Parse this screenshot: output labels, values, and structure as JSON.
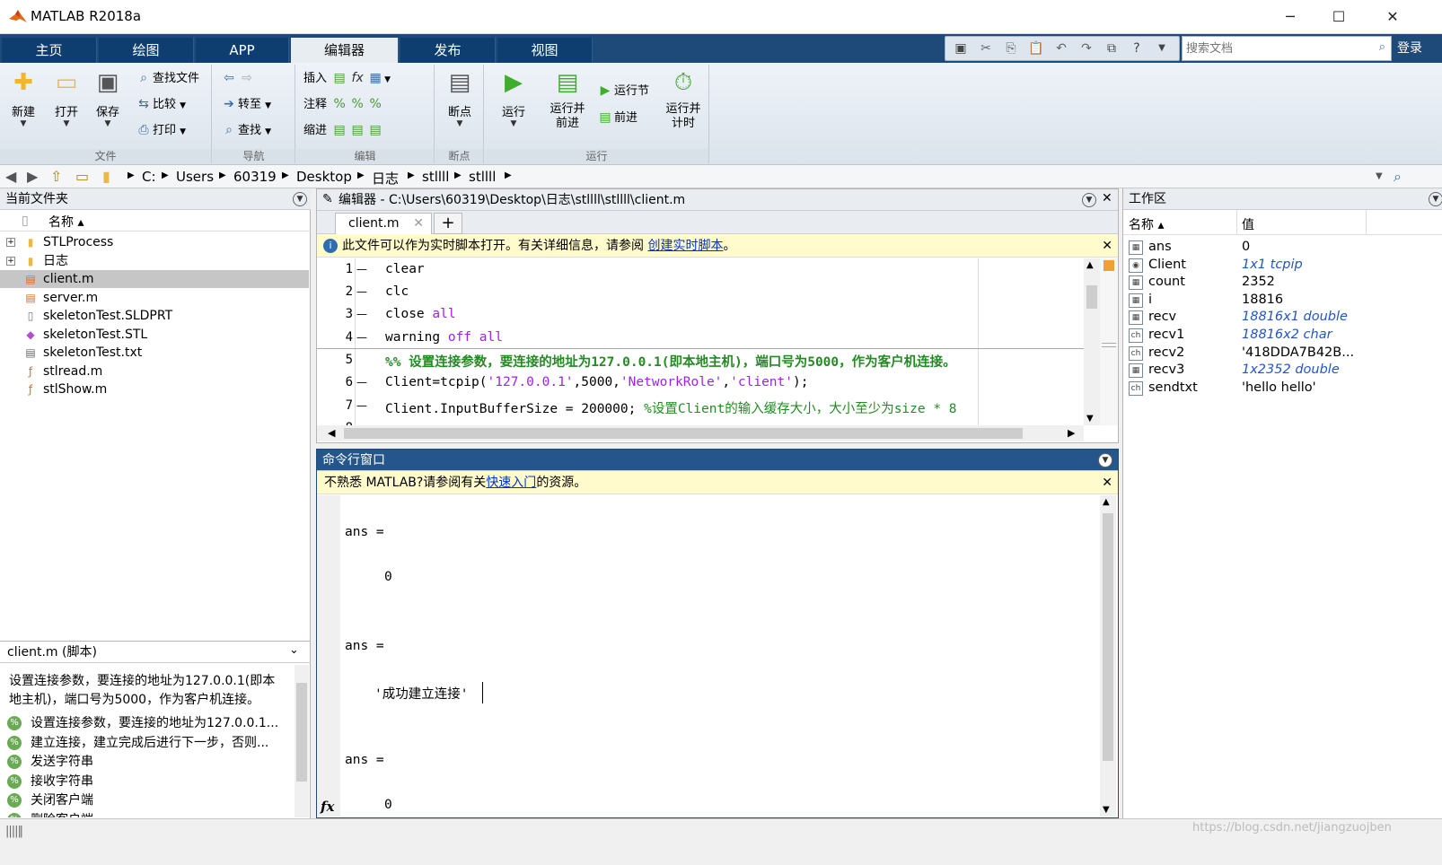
{
  "window": {
    "title": "MATLAB R2018a",
    "min": "─",
    "max": "☐",
    "close": "✕"
  },
  "ribbon_tabs": [
    "主页",
    "绘图",
    "APP",
    "编辑器",
    "发布",
    "视图"
  ],
  "search": {
    "placeholder": "搜索文档"
  },
  "login": "登录",
  "ribbon": {
    "file": {
      "label": "文件",
      "new": "新建",
      "open": "打开",
      "save": "保存",
      "find_files": "查找文件",
      "compare": "比较",
      "print": "打印"
    },
    "nav": {
      "label": "导航",
      "goto": "转至",
      "find": "查找"
    },
    "edit": {
      "label": "编辑",
      "insert": "插入",
      "comment": "注释",
      "indent": "缩进"
    },
    "breakpoint": {
      "label": "断点",
      "btn": "断点"
    },
    "run": {
      "label": "运行",
      "run": "运行",
      "run_advance": "运行并\n前进",
      "run_section": "运行节",
      "advance": "前进",
      "run_time": "运行并\n计时"
    }
  },
  "address": [
    "C:",
    "Users",
    "60319",
    "Desktop",
    "日志",
    "stllll",
    "stllll"
  ],
  "current_folder": {
    "title": "当前文件夹",
    "col_name": "名称 ▴",
    "items": [
      {
        "name": "STLProcess",
        "type": "folder"
      },
      {
        "name": "日志",
        "type": "folder"
      },
      {
        "name": "client.m",
        "type": "m",
        "selected": true
      },
      {
        "name": "server.m",
        "type": "m"
      },
      {
        "name": "skeletonTest.SLDPRT",
        "type": "file"
      },
      {
        "name": "skeletonTest.STL",
        "type": "stl"
      },
      {
        "name": "skeletonTest.txt",
        "type": "txt"
      },
      {
        "name": "stlread.m",
        "type": "fx"
      },
      {
        "name": "stlShow.m",
        "type": "fx"
      }
    ]
  },
  "details": {
    "title": "client.m (脚本)",
    "desc": "设置连接参数，要连接的地址为127.0.0.1(即本地主机)，端口号为5000，作为客户机连接。",
    "outline": [
      "设置连接参数，要连接的地址为127.0.0.1...",
      "建立连接，建立完成后进行下一步，否则...",
      "发送字符串",
      "接收字符串",
      "关闭客户端",
      "删除客户端"
    ]
  },
  "editor": {
    "title": "编辑器 - C:\\Users\\60319\\Desktop\\日志\\stllll\\stllll\\client.m",
    "tab": "client.m",
    "notice": "此文件可以作为实时脚本打开。有关详细信息，请参阅",
    "notice_link": "创建实时脚本",
    "notice_end": "。"
  },
  "command": {
    "title": "命令行窗口",
    "notice": "不熟悉 MATLAB?请参阅有关",
    "notice_link": "快速入门",
    "notice_end": "的资源。",
    "lines": [
      "ans =",
      "0",
      "ans =",
      "'成功建立连接'",
      "ans =",
      "0"
    ],
    "fx": "fx"
  },
  "workspace": {
    "title": "工作区",
    "col_name": "名称 ▴",
    "col_value": "值",
    "vars": [
      {
        "name": "ans",
        "value": "0",
        "italic": false
      },
      {
        "name": "Client",
        "value": "1x1 tcpip",
        "italic": true
      },
      {
        "name": "count",
        "value": "2352",
        "italic": false
      },
      {
        "name": "i",
        "value": "18816",
        "italic": false
      },
      {
        "name": "recv",
        "value": "18816x1 double",
        "italic": true
      },
      {
        "name": "recv1",
        "value": "18816x2 char",
        "italic": true
      },
      {
        "name": "recv2",
        "value": "'418DDA7B42B...",
        "italic": false
      },
      {
        "name": "recv3",
        "value": "1x2352 double",
        "italic": true
      },
      {
        "name": "sendtxt",
        "value": "'hello hello'",
        "italic": false
      }
    ]
  },
  "watermark": "https://blog.csdn.net/jiangzuojben"
}
